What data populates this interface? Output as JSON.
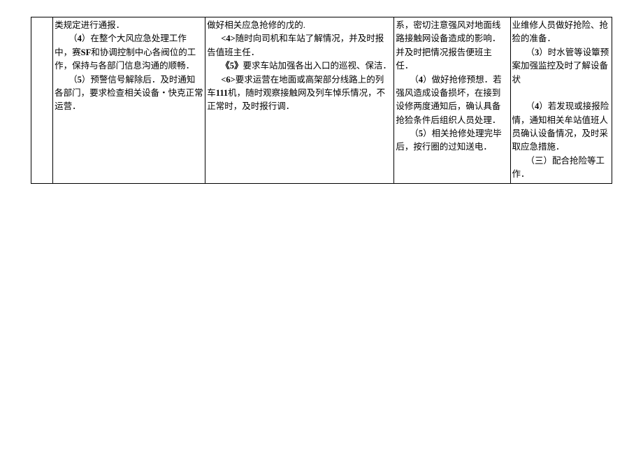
{
  "cells": {
    "c1": {
      "p1": "类规定进行通报．",
      "p2_pre": "（",
      "p2_num": "4",
      "p2_post": "）在整个大风应急处理工作中，赛",
      "p2_sf": "SF",
      "p2_tail": "和协调控制中心各阀位的工作，保持与各部门信息沟通的顺畅．",
      "p3_pre": "（",
      "p3_num": "5",
      "p3_post": "）预警信号解除后．及时通知各部门，要求检查相关设备・快克正常运营．"
    },
    "c2": {
      "p1": "做好相关应急抢修的戊的.",
      "p2_num": "<4>",
      "p2_txt": "随时向司机和车站了解情况，并及时报告值班主任．",
      "p3_num": "《5》",
      "p3_txt": "要求车站加强各出入口的巡视、保洁．",
      "p4_num": "<6>",
      "p4_txt_a": "要求运营在地面或高架部分线路上的列车",
      "p4_111": "111",
      "p4_txt_b": "机，随时观察接触网及列车悼乐情况，不正常时，及时报行调．"
    },
    "c3": {
      "p1": "系，密切注意强风对地面线路接触网设备造成的影响．并及时把情况报告便班主任．",
      "p2_pre": "（",
      "p2_num": "4",
      "p2_post": "）做好抢修预想．若强风造成设备损坏，在接到设修两度通知后，确认具备抢猃条件后组织人员处理．",
      "p3_pre": "（",
      "p3_num": "5",
      "p3_post": "）相关抢修处理完毕后，按行圈的过知送电．"
    },
    "c4": {
      "p1": "业维修人员做好抢险、抢猃的准备．",
      "p2_pre": "（",
      "p2_num": "3",
      "p2_post": "）时水管等设簟预案加强监控及时了解设备状",
      "p3_pre": "（",
      "p3_num": "4",
      "p3_post": "）若发现或接报险情，通知相关牟站值班人员确认设备情况，及时采取应急措施．",
      "p4": "（三）配合抢险等工作．"
    }
  }
}
